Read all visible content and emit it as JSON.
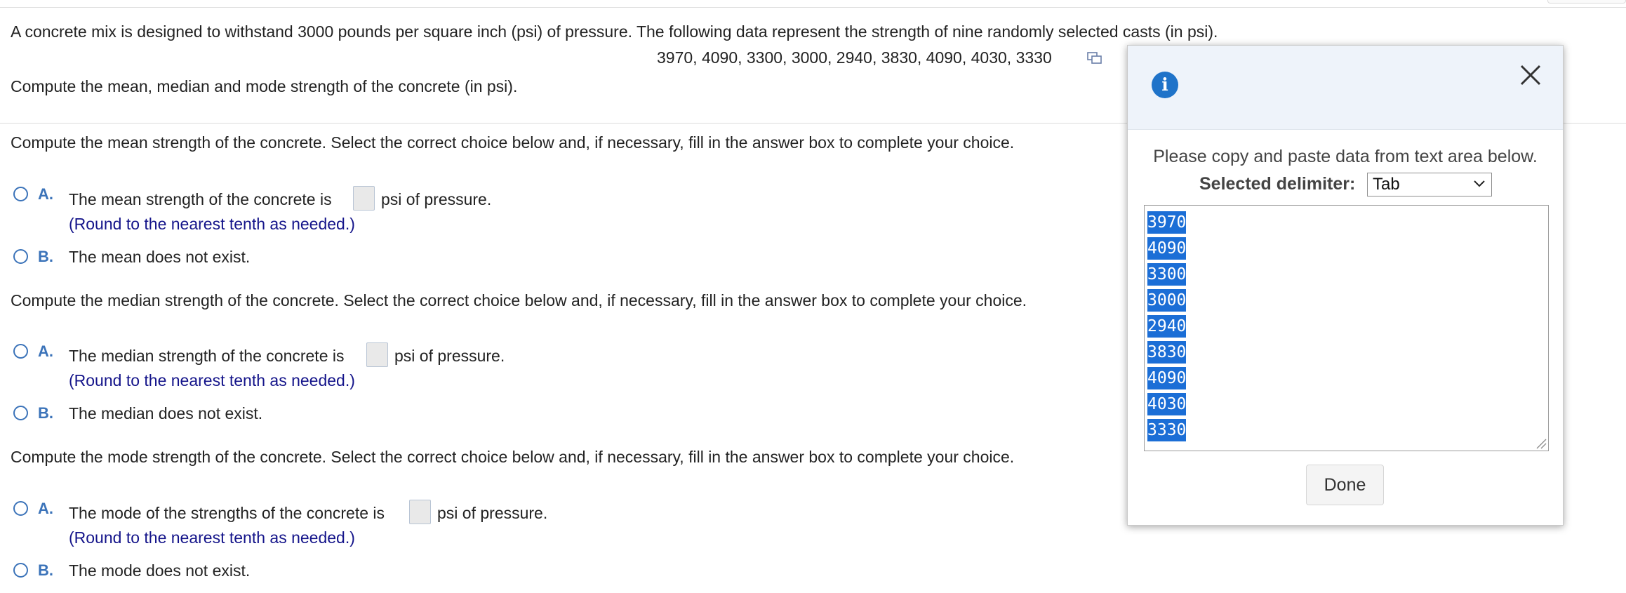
{
  "problem": {
    "intro": "A concrete mix is designed to withstand 3000 pounds per square inch (psi) of pressure. The following data represent the strength of nine randomly selected casts (in psi).",
    "data_line": "3970, 4090, 3300, 3000, 2940, 3830, 4090, 4030, 3330",
    "data_icon": "copy-data-icon",
    "task": "Compute the mean, median and mode strength of the concrete (in psi)."
  },
  "mean": {
    "prompt": "Compute the mean strength of the concrete. Select the correct choice below and, if necessary, fill in the answer box to complete your choice.",
    "option_a_letter": "A.",
    "option_a_before": "The mean strength of the concrete is",
    "option_a_after": "psi of pressure.",
    "option_a_hint": "(Round to the nearest tenth as needed.)",
    "option_b_letter": "B.",
    "option_b_text": "The mean does not exist."
  },
  "median": {
    "prompt": "Compute the median strength of the concrete. Select the correct choice below and, if necessary, fill in the answer box to complete your choice.",
    "option_a_letter": "A.",
    "option_a_before": "The median strength of the concrete is",
    "option_a_after": "psi of pressure.",
    "option_a_hint": "(Round to the nearest tenth as needed.)",
    "option_b_letter": "B.",
    "option_b_text": "The median does not exist."
  },
  "mode": {
    "prompt": "Compute the mode strength of the concrete. Select the correct choice below and, if necessary, fill in the answer box to complete your choice.",
    "option_a_letter": "A.",
    "option_a_before": "The mode of the strengths of the concrete is",
    "option_a_after": "psi of pressure.",
    "option_a_hint": "(Round to the nearest tenth as needed.)",
    "option_b_letter": "B.",
    "option_b_text": "The mode does not exist."
  },
  "popup": {
    "info_icon": "i",
    "close_icon": "close-icon",
    "message": "Please copy and paste data from text area below.",
    "delimiter_label": "Selected delimiter:",
    "delimiter_value": "Tab",
    "data_values": [
      "3970",
      "4090",
      "3300",
      "3000",
      "2940",
      "3830",
      "4090",
      "4030",
      "3330"
    ],
    "done_label": "Done"
  },
  "colors": {
    "link_blue": "#3b73b9",
    "hint_navy": "#14148a",
    "selection_blue": "#1b6ed6",
    "info_blue": "#1f73c9",
    "popup_header_bg": "#eef3fa"
  }
}
